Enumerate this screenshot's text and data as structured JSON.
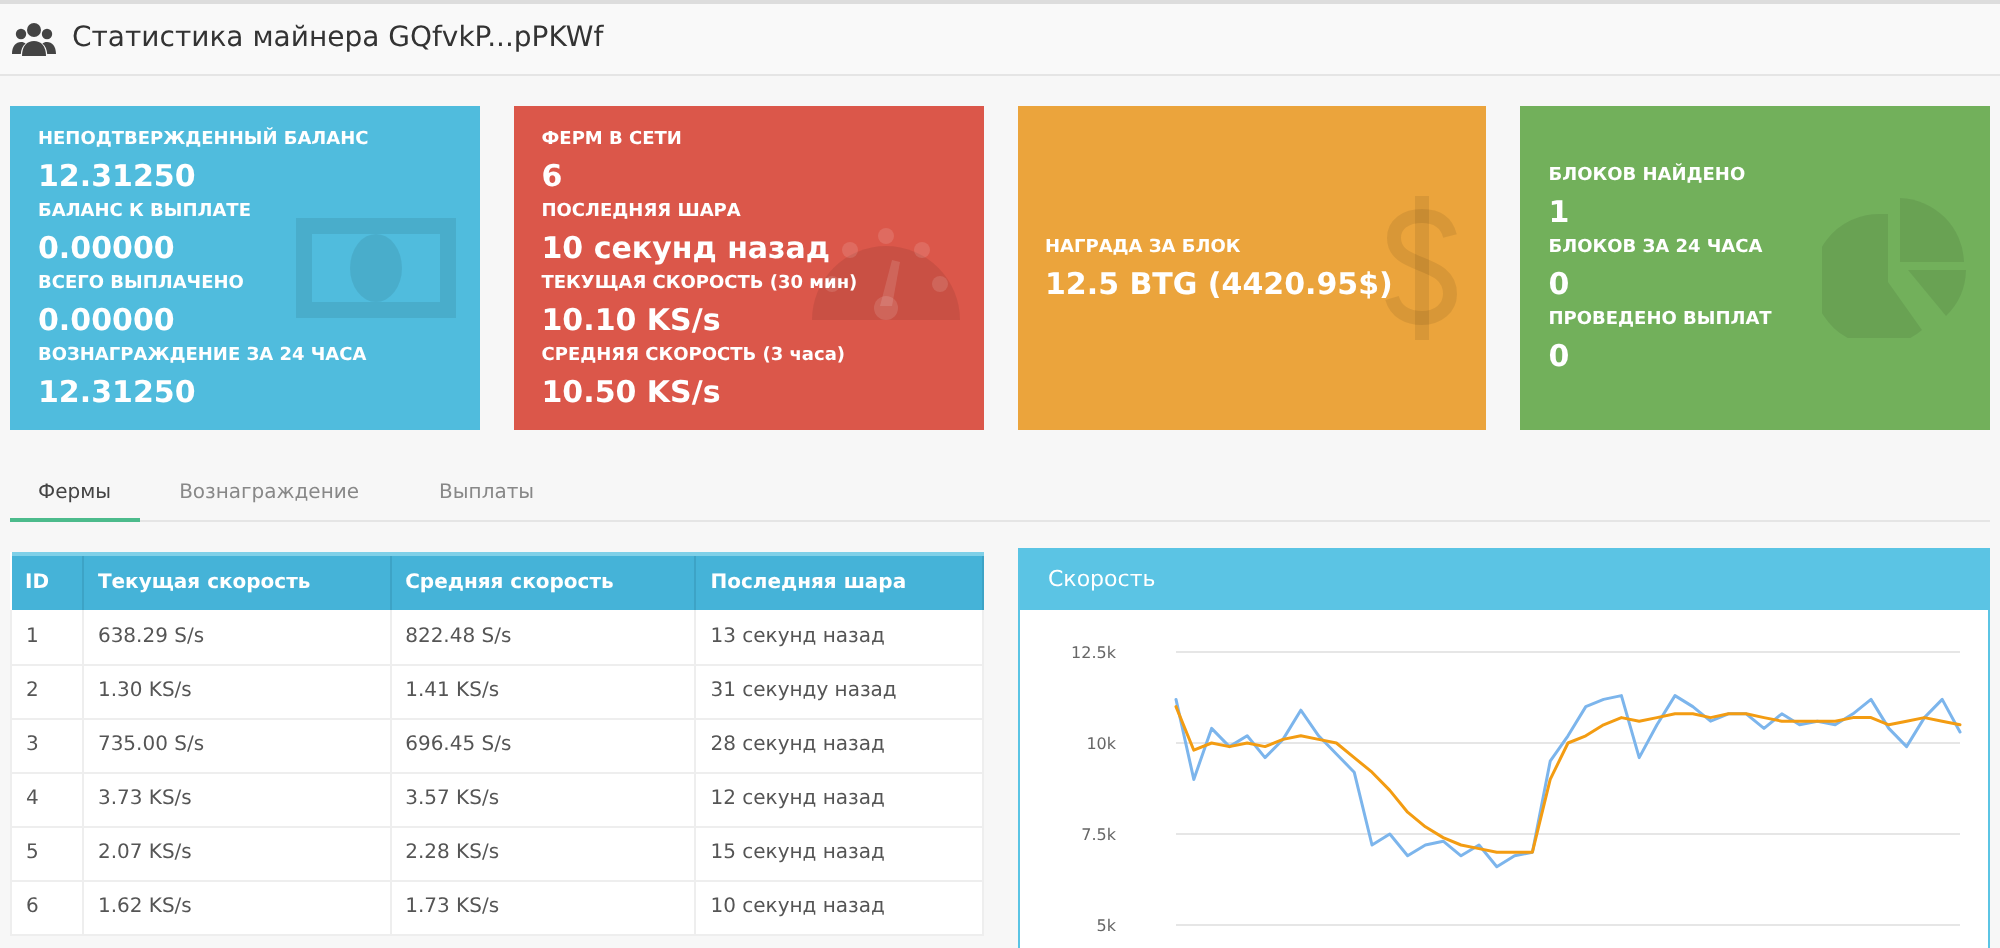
{
  "header": {
    "title": "Статистика майнера GQfvkP...pPKWf"
  },
  "cards": [
    {
      "kind": "money",
      "color": "#50bcdd",
      "stats": [
        {
          "label": "НЕПОДТВЕРЖДЕННЫЙ БАЛАНС",
          "value": "12.31250"
        },
        {
          "label": "БАЛАНС К ВЫПЛАТЕ",
          "value": "0.00000"
        },
        {
          "label": "ВСЕГО ВЫПЛАЧЕНО",
          "value": "0.00000"
        },
        {
          "label": "ВОЗНАГРАЖДЕНИЕ ЗА 24 ЧАСА",
          "value": "12.31250"
        }
      ]
    },
    {
      "kind": "gauge",
      "color": "#db574a",
      "stats": [
        {
          "label": "ФЕРМ В СЕТИ",
          "value": "6"
        },
        {
          "label": "ПОСЛЕДНЯЯ ШАРА",
          "value": "10 секунд назад"
        },
        {
          "label": "ТЕКУЩАЯ СКОРОСТЬ (30 мин)",
          "value": "10.10 KS/s"
        },
        {
          "label": "СРЕДНЯЯ СКОРОСТЬ (3 часа)",
          "value": "10.50 KS/s"
        }
      ]
    },
    {
      "kind": "dollar",
      "color": "#eba43c",
      "stats": [
        {
          "label": "НАГРАДА ЗА БЛОК",
          "value": "12.5 BTG (4420.95$)"
        }
      ]
    },
    {
      "kind": "pie",
      "color": "#72b05b",
      "stats": [
        {
          "label": "БЛОКОВ НАЙДЕНО",
          "value": "1"
        },
        {
          "label": "БЛОКОВ ЗА 24 ЧАСА",
          "value": "0"
        },
        {
          "label": "ПРОВЕДЕНО ВЫПЛАТ",
          "value": "0"
        }
      ]
    }
  ],
  "tabs": [
    {
      "label": "Фермы",
      "selected": true
    },
    {
      "label": "Вознаграждение",
      "selected": false
    },
    {
      "label": "Выплаты",
      "selected": false
    }
  ],
  "table": {
    "columns": [
      "ID",
      "Текущая скорость",
      "Средняя скорость",
      "Последняя шара"
    ],
    "rows": [
      [
        "1",
        "638.29 S/s",
        "822.48 S/s",
        "13 секунд назад"
      ],
      [
        "2",
        "1.30 KS/s",
        "1.41 KS/s",
        "31 секунду назад"
      ],
      [
        "3",
        "735.00 S/s",
        "696.45 S/s",
        "28 секунд назад"
      ],
      [
        "4",
        "3.73 KS/s",
        "3.57 KS/s",
        "12 секунд назад"
      ],
      [
        "5",
        "2.07 KS/s",
        "2.28 KS/s",
        "15 секунд назад"
      ],
      [
        "6",
        "1.62 KS/s",
        "1.73 KS/s",
        "10 секунд назад"
      ]
    ]
  },
  "chart_panel": {
    "title": "Скорость",
    "chart_data": {
      "type": "line",
      "grid": true,
      "ylim": [
        5000,
        12500
      ],
      "yticks": [
        {
          "value": 5000,
          "label": "5k"
        },
        {
          "value": 7500,
          "label": "7.5k"
        },
        {
          "value": 10000,
          "label": "10k"
        },
        {
          "value": 12500,
          "label": "12.5k"
        }
      ],
      "series": [
        {
          "color": "#7cb5ec",
          "values": [
            11200,
            9000,
            10400,
            9900,
            10200,
            9600,
            10100,
            10900,
            10200,
            9700,
            9200,
            7200,
            7500,
            6900,
            7200,
            7300,
            6900,
            7200,
            6600,
            6900,
            7000,
            9500,
            10200,
            11000,
            11200,
            11300,
            9600,
            10500,
            11300,
            11000,
            10600,
            10800,
            10800,
            10400,
            10800,
            10500,
            10600,
            10500,
            10800,
            11200,
            10400,
            9900,
            10700,
            11200,
            10300
          ]
        },
        {
          "color": "#f39c12",
          "values": [
            11000,
            9800,
            10000,
            9900,
            10000,
            9900,
            10100,
            10200,
            10100,
            10000,
            9600,
            9200,
            8700,
            8100,
            7700,
            7400,
            7200,
            7100,
            7000,
            7000,
            7000,
            9000,
            10000,
            10200,
            10500,
            10700,
            10600,
            10700,
            10800,
            10800,
            10700,
            10800,
            10800,
            10700,
            10600,
            10600,
            10600,
            10600,
            10700,
            10700,
            10500,
            10600,
            10700,
            10600,
            10500
          ]
        }
      ]
    }
  }
}
